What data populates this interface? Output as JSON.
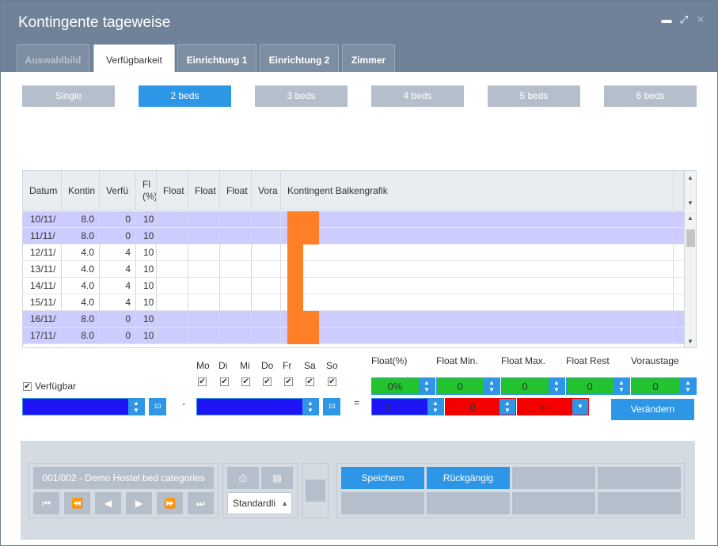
{
  "window": {
    "title": "Kontingente tageweise"
  },
  "tabs": [
    {
      "label": "Auswahlbild"
    },
    {
      "label": "Verfügbarkeit"
    },
    {
      "label": "Einrichtung 1"
    },
    {
      "label": "Einrichtung 2"
    },
    {
      "label": "Zimmer"
    }
  ],
  "beds": [
    {
      "label": "Single"
    },
    {
      "label": "2 beds"
    },
    {
      "label": "3 beds"
    },
    {
      "label": "4 beds"
    },
    {
      "label": "5 beds"
    },
    {
      "label": "6 beds"
    }
  ],
  "grid": {
    "headers": [
      "Datum",
      "Kontin",
      "Verfü",
      "Fl",
      "(%)",
      "Float",
      "Float",
      "Float",
      "Vora",
      "Kontingent Balkengrafik"
    ],
    "rows": [
      {
        "datum": "10/11/",
        "kontingent": "8.0",
        "verfuegbar": "0",
        "float": "10",
        "bar": 8
      },
      {
        "datum": "11/11/",
        "kontingent": "8.0",
        "verfuegbar": "0",
        "float": "10",
        "bar": 8
      },
      {
        "datum": "12/11/",
        "kontingent": "4.0",
        "verfuegbar": "4",
        "float": "10",
        "bar": 4
      },
      {
        "datum": "13/11/",
        "kontingent": "4.0",
        "verfuegbar": "4",
        "float": "10",
        "bar": 4
      },
      {
        "datum": "14/11/",
        "kontingent": "4.0",
        "verfuegbar": "4",
        "float": "10",
        "bar": 4
      },
      {
        "datum": "15/11/",
        "kontingent": "4.0",
        "verfuegbar": "4",
        "float": "10",
        "bar": 4
      },
      {
        "datum": "16/11/",
        "kontingent": "8.0",
        "verfuegbar": "0",
        "float": "10",
        "bar": 8
      },
      {
        "datum": "17/11/",
        "kontingent": "8.0",
        "verfuegbar": "0",
        "float": "10",
        "bar": 8
      }
    ]
  },
  "filters": {
    "verfuegbar_label": "Verfügbar",
    "dash": "-",
    "equals": "=",
    "days": [
      "Mo",
      "Di",
      "Mi",
      "Do",
      "Fr",
      "Sa",
      "So"
    ],
    "float_labels": [
      "Float(%)",
      "Float Min.",
      "Float Max.",
      "Float Rest",
      "Voraustage"
    ],
    "float_values": [
      "0%",
      "0",
      "0",
      "0",
      "0"
    ],
    "row2_values": [
      "0",
      "0",
      "+ -"
    ],
    "veraendern_label": "Verändern"
  },
  "bottom": {
    "record_label": "001/002 - Demo Hostel bed categories",
    "list_label": "Standardli",
    "save_label": "Speichern",
    "undo_label": "Rückgängig"
  },
  "colors": {
    "accent": "#2e96e6",
    "bar": "#ff7f27",
    "selected_row": "#ccccff",
    "green": "#22c32e",
    "red": "#f50000",
    "combo_blue": "#1f14f5"
  }
}
